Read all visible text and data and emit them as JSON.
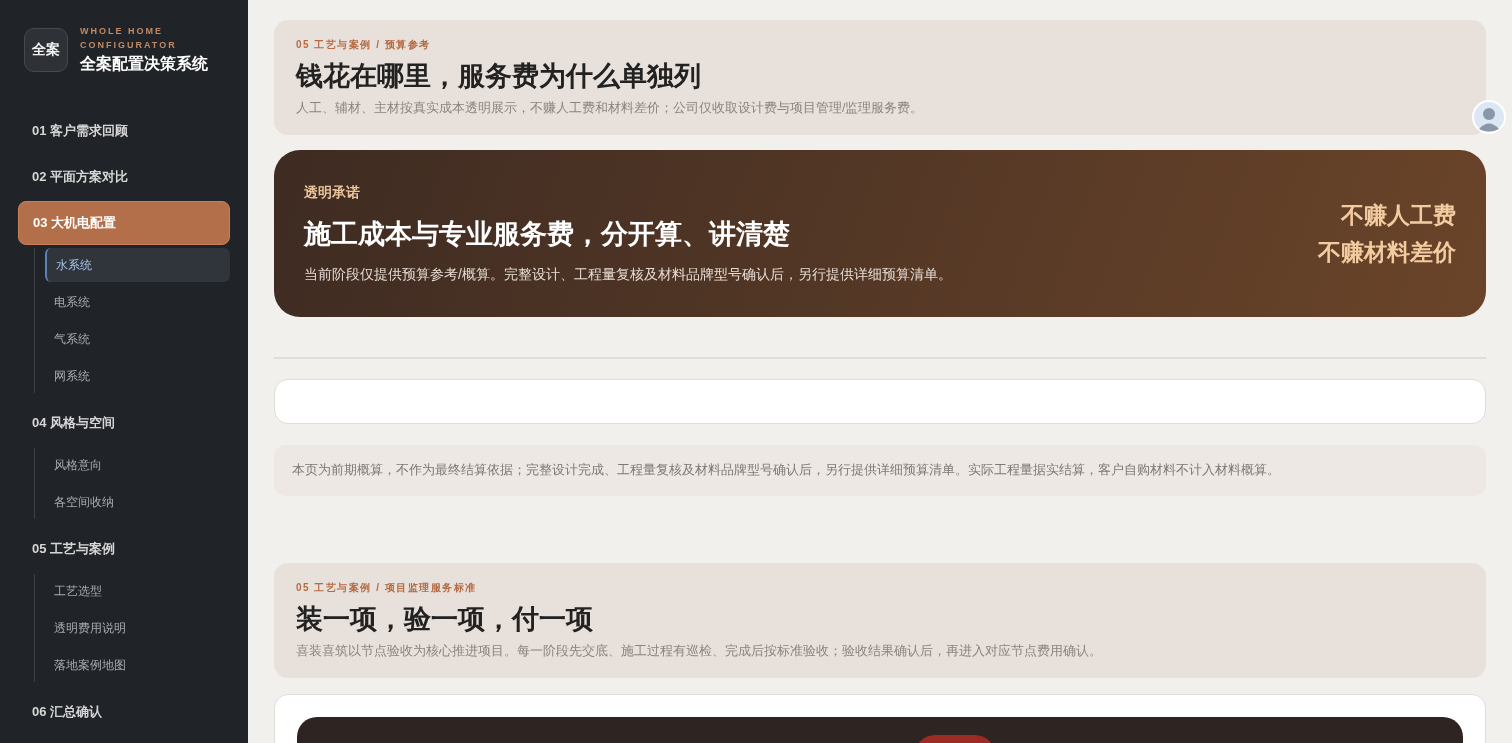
{
  "brand": {
    "badge": "全案",
    "eyebrow": "WHOLE HOME CONFIGURATOR",
    "title": "全案配置决策系统"
  },
  "sidebar": {
    "items": [
      {
        "label": "01 客户需求回顾",
        "selected": false
      },
      {
        "label": "02 平面方案对比",
        "selected": false
      },
      {
        "label": "03 大机电配置",
        "selected": true,
        "children": [
          {
            "label": "水系统",
            "selected": true
          },
          {
            "label": "电系统",
            "selected": false
          },
          {
            "label": "气系统",
            "selected": false
          },
          {
            "label": "网系统",
            "selected": false
          }
        ]
      },
      {
        "label": "04 风格与空间",
        "selected": false,
        "children": [
          {
            "label": "风格意向",
            "selected": false
          },
          {
            "label": "各空间收纳",
            "selected": false
          }
        ]
      },
      {
        "label": "05 工艺与案例",
        "selected": false,
        "children": [
          {
            "label": "工艺选型",
            "selected": false
          },
          {
            "label": "透明费用说明",
            "selected": false
          },
          {
            "label": "落地案例地图",
            "selected": false
          }
        ]
      },
      {
        "label": "06 汇总确认",
        "selected": false
      }
    ]
  },
  "budget_section": {
    "breadcrumb": "05 工艺与案例 / 预算参考",
    "title": "钱花在哪里，服务费为什么单独列",
    "subtitle": "人工、辅材、主材按真实成本透明展示，不赚人工费和材料差价；公司仅收取设计费与项目管理/监理服务费。"
  },
  "promise_card": {
    "tag": "透明承诺",
    "title": "施工成本与专业服务费，分开算、讲清楚",
    "body": "当前阶段仅提供预算参考/概算。完整设计、工程量复核及材料品牌型号确认后，另行提供详细预算清单。",
    "highlights": [
      "不赚人工费",
      "不赚材料差价"
    ]
  },
  "disclaimer": "本页为前期概算，不作为最终结算依据；完整设计完成、工程量复核及材料品牌型号确认后，另行提供详细预算清单。实际工程量据实结算，客户自购材料不计入材料概算。",
  "supervision_section": {
    "breadcrumb": "05 工艺与案例 / 项目监理服务标准",
    "title": "装一项，验一项，付一项",
    "subtitle": "喜装喜筑以节点验收为核心推进项目。每一阶段先交底、施工过程有巡检、完成后按标准验收；验收结果确认后，再进入对应节点费用确认。"
  }
}
